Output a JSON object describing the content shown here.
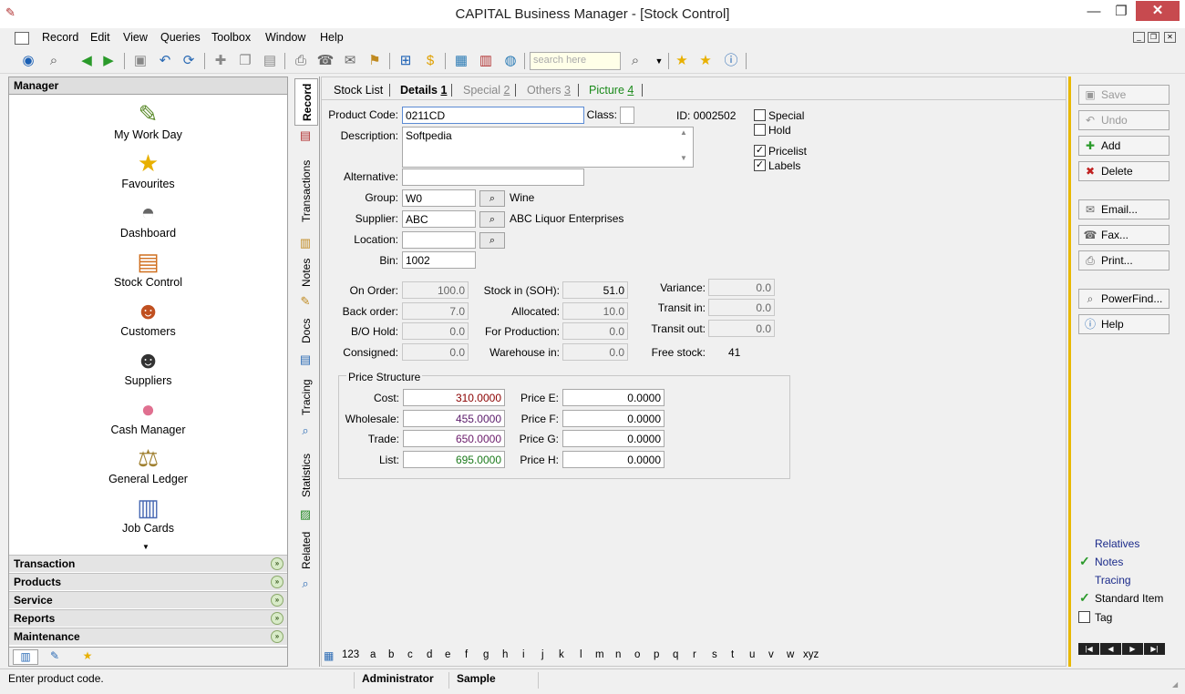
{
  "window": {
    "title": "CAPITAL Business Manager - [Stock Control]"
  },
  "menu": [
    "Record",
    "Edit",
    "View",
    "Queries",
    "Toolbox",
    "Window",
    "Help"
  ],
  "toolbar": {
    "search_placeholder": "search here"
  },
  "manager": {
    "header": "Manager",
    "items": [
      {
        "label": "My Work Day",
        "icon": "clipboard-icon"
      },
      {
        "label": "Favourites",
        "icon": "star-icon"
      },
      {
        "label": "Dashboard",
        "icon": "gauge-icon"
      },
      {
        "label": "Stock Control",
        "icon": "stock-icon"
      },
      {
        "label": "Customers",
        "icon": "customers-icon"
      },
      {
        "label": "Suppliers",
        "icon": "suppliers-icon"
      },
      {
        "label": "Cash Manager",
        "icon": "piggy-bank-icon"
      },
      {
        "label": "General Ledger",
        "icon": "scales-icon"
      },
      {
        "label": "Job Cards",
        "icon": "job-cards-icon"
      }
    ],
    "groups": [
      "Transaction",
      "Products",
      "Service",
      "Reports",
      "Maintenance"
    ]
  },
  "vtabs": [
    "Record",
    "Transactions",
    "Notes",
    "Docs",
    "Tracing",
    "Statistics",
    "Related"
  ],
  "tabs": [
    {
      "label": "Stock List"
    },
    {
      "label": "Details",
      "num": "1"
    },
    {
      "label": "Special",
      "num": "2"
    },
    {
      "label": "Others",
      "num": "3"
    },
    {
      "label": "Picture",
      "num": "4"
    }
  ],
  "form": {
    "product_code_label": "Product Code:",
    "product_code": "0211CD",
    "class_label": "Class:",
    "id_text": "ID: 0002502",
    "description_label": "Description:",
    "description": "Softpedia",
    "alternative_label": "Alternative:",
    "alternative": "",
    "group_label": "Group:",
    "group": "W0",
    "group_name": "Wine",
    "supplier_label": "Supplier:",
    "supplier": "ABC",
    "supplier_name": "ABC Liquor Enterprises",
    "location_label": "Location:",
    "location": "",
    "bin_label": "Bin:",
    "bin": "1002",
    "checks": [
      {
        "label": "Special",
        "checked": false
      },
      {
        "label": "Hold",
        "checked": false
      },
      {
        "label": "Pricelist",
        "checked": true
      },
      {
        "label": "Labels",
        "checked": true
      }
    ]
  },
  "stock": {
    "on_order_label": "On Order:",
    "on_order": "100.0",
    "back_order_label": "Back order:",
    "back_order": "7.0",
    "bo_hold_label": "B/O Hold:",
    "bo_hold": "0.0",
    "consigned_label": "Consigned:",
    "consigned": "0.0",
    "soh_label": "Stock in (SOH):",
    "soh": "51.0",
    "allocated_label": "Allocated:",
    "allocated": "10.0",
    "for_production_label": "For Production:",
    "for_production": "0.0",
    "warehouse_label": "Warehouse in:",
    "warehouse": "0.0",
    "variance_label": "Variance:",
    "variance": "0.0",
    "transit_in_label": "Transit in:",
    "transit_in": "0.0",
    "transit_out_label": "Transit out:",
    "transit_out": "0.0",
    "free_stock_label": "Free stock:",
    "free_stock": "41"
  },
  "price": {
    "title": "Price Structure",
    "cost_label": "Cost:",
    "cost": "310.0000",
    "wholesale_label": "Wholesale:",
    "wholesale": "455.0000",
    "trade_label": "Trade:",
    "trade": "650.0000",
    "list_label": "List:",
    "list": "695.0000",
    "e_label": "Price E:",
    "e": "0.0000",
    "f_label": "Price F:",
    "f": "0.0000",
    "g_label": "Price G:",
    "g": "0.0000",
    "h_label": "Price H:",
    "h": "0.0000"
  },
  "alphabet": [
    "123",
    "a",
    "b",
    "c",
    "d",
    "e",
    "f",
    "g",
    "h",
    "i",
    "j",
    "k",
    "l",
    "m",
    "n",
    "o",
    "p",
    "q",
    "r",
    "s",
    "t",
    "u",
    "v",
    "w",
    "xyz"
  ],
  "actions": {
    "save": "Save",
    "undo": "Undo",
    "add": "Add",
    "delete": "Delete",
    "email": "Email...",
    "fax": "Fax...",
    "print": "Print...",
    "powerfind": "PowerFind...",
    "help": "Help"
  },
  "related": {
    "relatives": "Relatives",
    "notes": "Notes",
    "tracing": "Tracing",
    "standard_item": "Standard Item",
    "tag": "Tag"
  },
  "status": {
    "message": "Enter product code.",
    "user": "Administrator",
    "company": "Sample"
  },
  "colors": {
    "accent": "#e8b800",
    "close": "#c74a4f",
    "cost": "#8b0000",
    "wholesale": "#5a1a6a",
    "trade": "#6a1a6a",
    "list": "#1a7a1a"
  }
}
